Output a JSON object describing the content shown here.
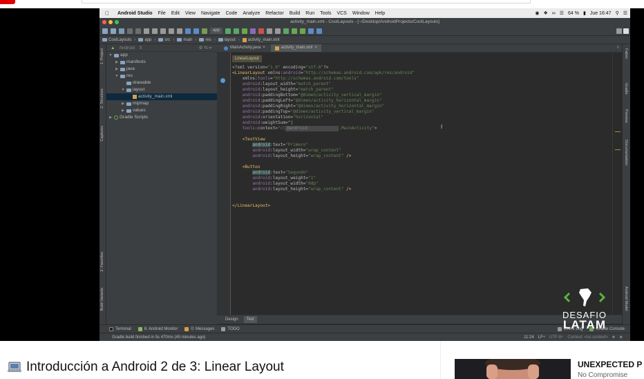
{
  "menubar": {
    "app_name": "Android Studio",
    "items": [
      "File",
      "Edit",
      "View",
      "Navigate",
      "Code",
      "Analyze",
      "Refactor",
      "Build",
      "Run",
      "Tools",
      "VCS",
      "Window",
      "Help"
    ],
    "battery": "64 %",
    "clock": "Jue 16:47"
  },
  "window_title": "activity_main.xml - CoolLayouts - [~/Desktop/AndroidProjects/CoolLayouts]",
  "toolbar": {
    "run_config": "app"
  },
  "breadcrumbs": [
    "CoolLayouts",
    "app",
    "src",
    "main",
    "res",
    "layout",
    "activity_main.xml"
  ],
  "left_tabs": {
    "project": "1: Project",
    "structure": "Z: Structure",
    "captures": "Captures",
    "favorites": "2: Favorites",
    "build_variants": "Build Variants"
  },
  "project_panel": {
    "view_mode": "Android",
    "tree": [
      {
        "label": "app",
        "level": 0,
        "arrow": "▼",
        "icon": "folder"
      },
      {
        "label": "manifests",
        "level": 1,
        "arrow": "▶",
        "icon": "folder"
      },
      {
        "label": "java",
        "level": 1,
        "arrow": "▶",
        "icon": "folder"
      },
      {
        "label": "res",
        "level": 1,
        "arrow": "▼",
        "icon": "folder"
      },
      {
        "label": "drawable",
        "level": 2,
        "arrow": "",
        "icon": "folder"
      },
      {
        "label": "layout",
        "level": 2,
        "arrow": "▼",
        "icon": "folder"
      },
      {
        "label": "activity_main.xml",
        "level": 3,
        "arrow": "",
        "icon": "xml",
        "selected": true
      },
      {
        "label": "mipmap",
        "level": 2,
        "arrow": "▶",
        "icon": "folder"
      },
      {
        "label": "values",
        "level": 2,
        "arrow": "▶",
        "icon": "folder"
      },
      {
        "label": "Gradle Scripts",
        "level": 0,
        "arrow": "▶",
        "icon": "gradle"
      }
    ]
  },
  "editor_tabs": [
    {
      "label": "MainActivity.java",
      "active": false
    },
    {
      "label": "activity_main.xml",
      "active": true
    }
  ],
  "editor": {
    "tag_breadcrumb": "LinearLayout",
    "autocomplete_hint": "@android:",
    "lines": [
      [
        [
          "t-attr",
          "<?xml version="
        ],
        [
          "t-val",
          "\"1.0\""
        ],
        [
          "t-attr",
          " encoding="
        ],
        [
          "t-val",
          "\"utf-8\""
        ],
        [
          "t-attr",
          "?>"
        ]
      ],
      [
        [
          "t-tag",
          "<LinearLayout "
        ],
        [
          "t-attr",
          "xmlns:"
        ],
        [
          "t-ns",
          "android"
        ],
        [
          "t-attr",
          "="
        ],
        [
          "t-val",
          "\"http://schemas.android.com/apk/res/android\""
        ]
      ],
      [
        [
          "",
          "    "
        ],
        [
          "t-attr",
          "xmlns:"
        ],
        [
          "t-ns",
          "tools"
        ],
        [
          "t-attr",
          "="
        ],
        [
          "t-val",
          "\"http://schemas.android.com/tools\""
        ]
      ],
      [
        [
          "",
          "    "
        ],
        [
          "t-ns",
          "android"
        ],
        [
          "t-attr",
          ":layout_width="
        ],
        [
          "t-val",
          "\"match_parent\""
        ]
      ],
      [
        [
          "",
          "    "
        ],
        [
          "t-ns",
          "android"
        ],
        [
          "t-attr",
          ":layout_height="
        ],
        [
          "t-val",
          "\"match_parent\""
        ]
      ],
      [
        [
          "",
          "    "
        ],
        [
          "t-ns",
          "android"
        ],
        [
          "t-attr",
          ":paddingBottom="
        ],
        [
          "t-val",
          "\"@dimen/activity_vertical_margin\""
        ]
      ],
      [
        [
          "",
          "    "
        ],
        [
          "t-ns",
          "android"
        ],
        [
          "t-attr",
          ":paddingLeft="
        ],
        [
          "t-val",
          "\"@dimen/activity_horizontal_margin\""
        ]
      ],
      [
        [
          "",
          "    "
        ],
        [
          "t-ns",
          "android"
        ],
        [
          "t-attr",
          ":paddingRight="
        ],
        [
          "t-val",
          "\"@dimen/activity_horizontal_margin\""
        ]
      ],
      [
        [
          "",
          "    "
        ],
        [
          "t-ns",
          "android"
        ],
        [
          "t-attr",
          ":paddingTop="
        ],
        [
          "t-val",
          "\"@dimen/activity_vertical_margin\""
        ]
      ],
      [
        [
          "",
          "    "
        ],
        [
          "t-ns",
          "android"
        ],
        [
          "t-attr",
          ":orientation="
        ],
        [
          "t-val",
          "\"horizontal\""
        ]
      ],
      [
        [
          "",
          "    "
        ],
        [
          "t-ns",
          "android"
        ],
        [
          "t-attr",
          ":weightSum=\"|"
        ]
      ],
      [
        [
          "",
          "    "
        ],
        [
          "t-ns",
          "tools"
        ],
        [
          "t-attr",
          ":context="
        ],
        [
          "t-val",
          "\"cl"
        ],
        [
          "popup",
          "@android:           "
        ],
        [
          "t-val",
          ".MainActivity\""
        ],
        [
          "t-attr",
          ">"
        ]
      ],
      [
        [
          "",
          ""
        ]
      ],
      [
        [
          "",
          "    "
        ],
        [
          "t-tag",
          "<TextView"
        ]
      ],
      [
        [
          "",
          "        "
        ],
        [
          "t-hl",
          "android"
        ],
        [
          "t-attr",
          ":text="
        ],
        [
          "t-val",
          "\"Primero\""
        ]
      ],
      [
        [
          "",
          "        "
        ],
        [
          "t-ns",
          "android"
        ],
        [
          "t-attr",
          ":layout_width="
        ],
        [
          "t-val",
          "\"wrap_content\""
        ]
      ],
      [
        [
          "",
          "        "
        ],
        [
          "t-ns",
          "android"
        ],
        [
          "t-attr",
          ":layout_height="
        ],
        [
          "t-val",
          "\"wrap_content\""
        ],
        [
          "t-tag",
          " />"
        ]
      ],
      [
        [
          "",
          ""
        ]
      ],
      [
        [
          "",
          "    "
        ],
        [
          "t-tag",
          "<Button"
        ]
      ],
      [
        [
          "",
          "        "
        ],
        [
          "t-hl",
          "android"
        ],
        [
          "t-attr",
          ":text="
        ],
        [
          "t-val",
          "\"Segundo\""
        ]
      ],
      [
        [
          "",
          "        "
        ],
        [
          "t-ns",
          "android"
        ],
        [
          "t-attr",
          ":layout_weight="
        ],
        [
          "t-val",
          "\"1\""
        ]
      ],
      [
        [
          "",
          "        "
        ],
        [
          "t-ns",
          "android"
        ],
        [
          "t-attr",
          ":layout_width="
        ],
        [
          "t-val",
          "\"0dp\""
        ]
      ],
      [
        [
          "",
          "        "
        ],
        [
          "t-ns",
          "android"
        ],
        [
          "t-attr",
          ":layout_height="
        ],
        [
          "t-val",
          "\"wrap_content\""
        ],
        [
          "t-tag",
          " />"
        ]
      ],
      [
        [
          "",
          ""
        ]
      ],
      [
        [
          "",
          ""
        ]
      ],
      [
        [
          "t-tag",
          "</LinearLayout>"
        ]
      ]
    ]
  },
  "design_tabs": [
    {
      "label": "Design",
      "active": false
    },
    {
      "label": "Text",
      "active": true
    }
  ],
  "right_tabs": {
    "fabric": "Fabric",
    "gradle": "Gradle",
    "preview": "Preview",
    "documentation": "Documentation",
    "android_model": "Android Model"
  },
  "bottom_tools": {
    "terminal": "Terminal",
    "monitor": "6: Android Monitor",
    "messages": "0: Messages",
    "todo": "TODO",
    "event_log": "Event Log",
    "gradle_console": "Gradle Console"
  },
  "status": {
    "message": "Gradle build finished in 5s 470ms (45 minutes ago)",
    "position": "11:24",
    "line_sep": "LF÷",
    "encoding": "UTF-8÷",
    "context": "Context: <no context>"
  },
  "logo": {
    "line1": "DESAFIO",
    "line2": "LATAM"
  },
  "video_title": "Introducción a Android 2 de 3: Linear Layout",
  "up_next": {
    "title": "UNEXPECTED P",
    "channel": "No Compromise"
  }
}
